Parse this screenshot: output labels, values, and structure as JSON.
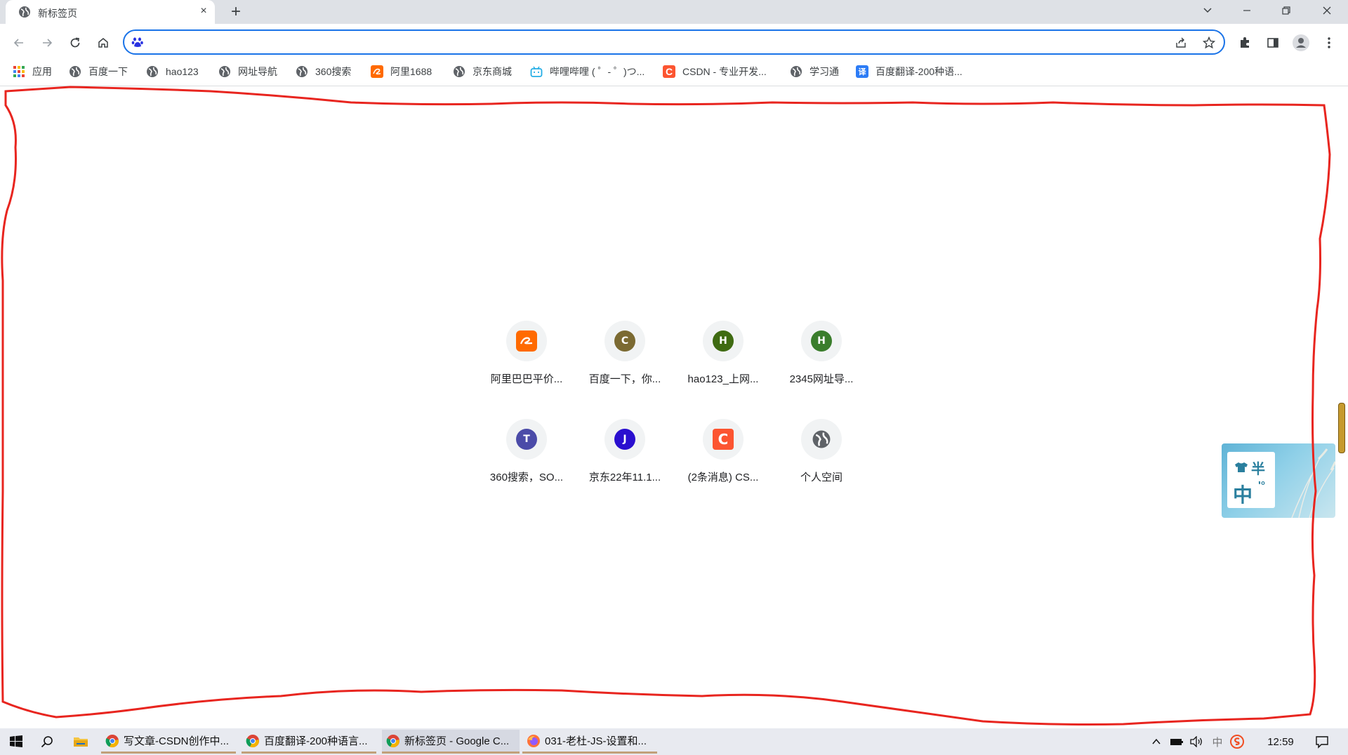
{
  "browser": {
    "tab": {
      "title": "新标签页",
      "close": "×"
    },
    "new_tab": "+",
    "window_controls": {
      "tab_search": "⌄",
      "minimize": "—",
      "restore": "❐",
      "close": "✕"
    },
    "address_bar": {
      "value": "",
      "placeholder": ""
    }
  },
  "bookmarks": [
    {
      "label": "应用",
      "icon": "apps-grid-icon"
    },
    {
      "label": "百度一下",
      "icon": "globe-icon"
    },
    {
      "label": "hao123",
      "icon": "globe-icon"
    },
    {
      "label": "网址导航",
      "icon": "globe-icon"
    },
    {
      "label": "360搜索",
      "icon": "globe-icon"
    },
    {
      "label": "阿里1688",
      "icon": "alibaba-icon",
      "color": "#ff6a00"
    },
    {
      "label": "京东商城",
      "icon": "globe-icon"
    },
    {
      "label": "哔哩哔哩 ( ゜- ゜)つ...",
      "icon": "bilibili-icon",
      "color": "#23ade5"
    },
    {
      "label": "CSDN - 专业开发...",
      "icon": "csdn-icon",
      "color": "#fc5531"
    },
    {
      "label": "学习通",
      "icon": "globe-icon"
    },
    {
      "label": "百度翻译-200种语...",
      "icon": "baidu-translate-icon",
      "color": "#2c7cf6",
      "glyph": "译"
    }
  ],
  "shortcuts": [
    {
      "label": "阿里巴巴平价...",
      "icon": "alibaba-icon",
      "letter": "",
      "color": "#ff6a00"
    },
    {
      "label": "百度一下，你...",
      "icon": "letter-c-icon",
      "letter": "C",
      "color": "#7b6a32"
    },
    {
      "label": "hao123_上网...",
      "icon": "letter-h-icon",
      "letter": "H",
      "color": "#3f6b12"
    },
    {
      "label": "2345网址导...",
      "icon": "letter-h-icon",
      "letter": "H",
      "color": "#3a7d2c"
    },
    {
      "label": "360搜索，SO...",
      "icon": "letter-t-icon",
      "letter": "T",
      "color": "#4b4ba8"
    },
    {
      "label": "京东22年11.1...",
      "icon": "letter-j-icon",
      "letter": "J",
      "color": "#2a0fcf"
    },
    {
      "label": "(2条消息) CS...",
      "icon": "csdn-icon",
      "letter": "C",
      "color": "#fc5531"
    },
    {
      "label": "个人空间",
      "icon": "globe-icon",
      "letter": "",
      "color": "#5f6368"
    }
  ],
  "ime_widget": {
    "line1": "半",
    "line2": "中",
    "line2_suffix": "'°"
  },
  "taskbar": {
    "items": [
      {
        "label": "写文章-CSDN创作中...",
        "icon": "chrome-icon"
      },
      {
        "label": "百度翻译-200种语言...",
        "icon": "chrome-icon"
      },
      {
        "label": "新标签页 - Google C...",
        "icon": "chrome-icon"
      },
      {
        "label": "031-老杜-JS-设置和...",
        "icon": "firefox-icon"
      }
    ],
    "tray": {
      "ime": "中",
      "time": "12:59"
    }
  },
  "colors": {
    "accent": "#1a73e8",
    "annotation": "#e8251f",
    "tabstrip": "#dee1e6"
  }
}
